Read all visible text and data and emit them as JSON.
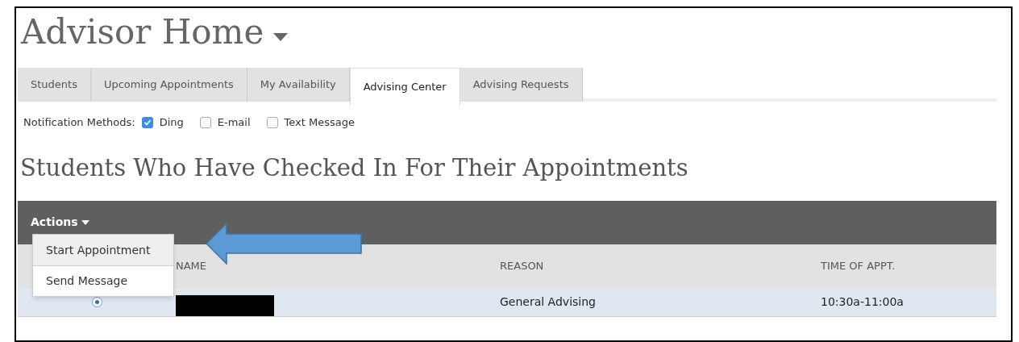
{
  "page": {
    "title": "Advisor Home"
  },
  "tabs": [
    {
      "label": "Students",
      "selected": false
    },
    {
      "label": "Upcoming Appointments",
      "selected": false
    },
    {
      "label": "My Availability",
      "selected": false
    },
    {
      "label": "Advising Center",
      "selected": true
    },
    {
      "label": "Advising Requests",
      "selected": false
    }
  ],
  "notifications": {
    "label": "Notification Methods:",
    "options": [
      {
        "label": "Ding",
        "checked": true
      },
      {
        "label": "E-mail",
        "checked": false
      },
      {
        "label": "Text Message",
        "checked": false
      }
    ]
  },
  "section_title": "Students Who Have Checked In For Their Appointments",
  "actions": {
    "label": "Actions",
    "expanded": true,
    "menu": [
      {
        "label": "Start Appointment",
        "selected": true
      },
      {
        "label": "Send Message",
        "selected": false
      }
    ]
  },
  "table": {
    "columns": [
      "NAME",
      "REASON",
      "TIME OF APPT."
    ],
    "rows": [
      {
        "selected": true,
        "name_redacted": true,
        "reason": "General Advising",
        "time": "10:30a-11:00a"
      }
    ]
  }
}
